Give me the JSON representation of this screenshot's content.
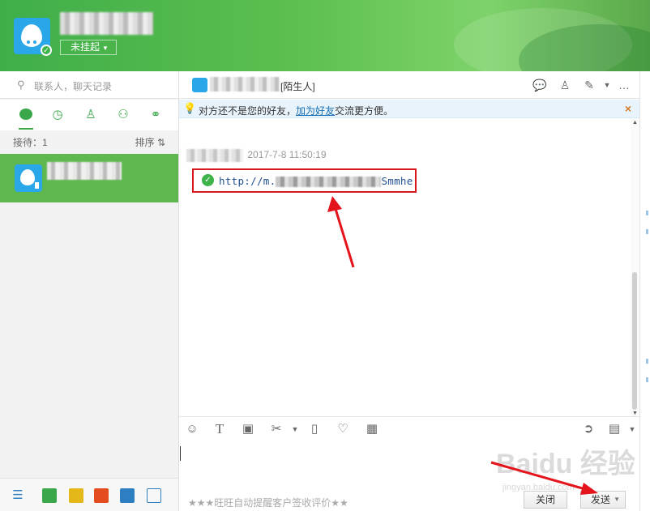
{
  "header": {
    "status_label": "未挂起"
  },
  "left": {
    "search_placeholder": "联系人，聊天记录",
    "reception_label": "接待：1",
    "sort_label": "排序 ⇅"
  },
  "chat": {
    "contact_tag": "[陌生人]",
    "notice_prefix": "对方还不是您的好友，",
    "notice_link": "加为好友",
    "notice_suffix": "交流更方便。",
    "message_time": "2017-7-8 11:50:19",
    "message_url_start": "http://m.",
    "message_url_end": "Smmhe"
  },
  "input": {
    "auto_prompt": "★★★旺旺自动提醒客户签收评价★★",
    "close_label": "关闭",
    "send_label": "发送"
  },
  "watermark": {
    "text": "Baidu 经验",
    "sub": "jingyan.baidu.com"
  },
  "colors": {
    "header_green": "#4cb54c",
    "accent_green": "#3aa84a",
    "highlight_red": "#d7191e",
    "notice_bg": "#e8f3fb"
  }
}
